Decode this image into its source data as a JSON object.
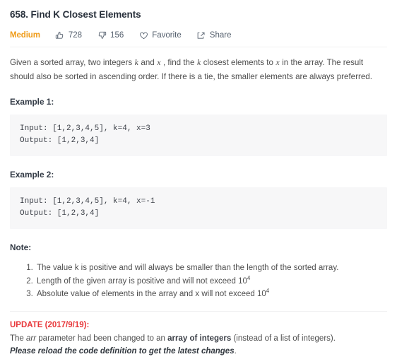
{
  "problem": {
    "title": "658. Find K Closest Elements",
    "difficulty": {
      "label": "Medium",
      "color": "#ef9b18"
    }
  },
  "meta": {
    "upvotes": "728",
    "downvotes": "156",
    "favorite_label": "Favorite",
    "share_label": "Share",
    "icons": {
      "upvote": "thumbs-up-icon",
      "downvote": "thumbs-down-icon",
      "favorite": "heart-icon",
      "share": "share-icon"
    }
  },
  "description": {
    "part1": "Given a sorted array, two integers",
    "var_k_1": "k",
    "part2": "and",
    "var_x_1": "x",
    "part3": ", find the",
    "var_k_2": "k",
    "part4": "closest elements to",
    "var_x_2": "x",
    "part5": "in the array. The result should also be sorted in ascending order. If there is a tie, the smaller elements are always preferred."
  },
  "examples": [
    {
      "heading": "Example 1:",
      "code": "Input: [1,2,3,4,5], k=4, x=3\nOutput: [1,2,3,4]"
    },
    {
      "heading": "Example 2:",
      "code": "Input: [1,2,3,4,5], k=4, x=-1\nOutput: [1,2,3,4]"
    }
  ],
  "note": {
    "heading": "Note:",
    "items": [
      {
        "text": "The value k is positive and will always be smaller than the length of the sorted array.",
        "base": "",
        "sup": ""
      },
      {
        "text": "Length of the given array is positive and will not exceed 10",
        "base": "10",
        "sup": "4"
      },
      {
        "text": "Absolute value of elements in the array and x will not exceed 10",
        "base": "10",
        "sup": "4"
      }
    ]
  },
  "update": {
    "heading": "UPDATE (2017/9/19):",
    "heading_color": "#e8373a",
    "body_prefix": "The ",
    "body_italic": "arr",
    "body_mid": " parameter had been changed to an ",
    "body_bold": "array of integers",
    "body_suffix": " (instead of a list of integers).",
    "final_line": "Please reload the code definition to get the latest changes",
    "final_period": "."
  }
}
